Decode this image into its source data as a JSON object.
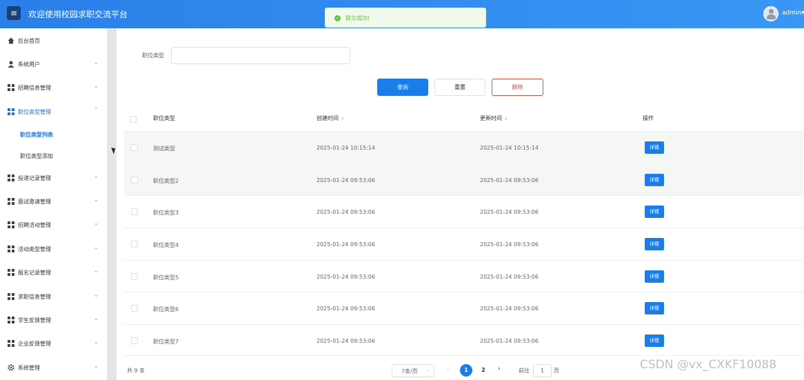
{
  "header": {
    "menu_icon": "hamburger-icon",
    "title": "欢迎使用校园求职交流平台",
    "username": "admin",
    "user_chevron": "▾",
    "accent": "#2a7fe8"
  },
  "toast": {
    "icon": "check-icon",
    "message": "提交成功!"
  },
  "sidebar": {
    "items": [
      {
        "label": "后台首页",
        "icon": "home-icon",
        "chevron": ""
      },
      {
        "label": "系统用户",
        "icon": "user-icon",
        "chevron": "⌄"
      },
      {
        "label": "招聘信息管理",
        "icon": "grid-icon",
        "chevron": "⌄"
      },
      {
        "label": "职位类型管理",
        "icon": "grid-icon",
        "chevron": "⌃"
      },
      {
        "label": "投递记录管理",
        "icon": "grid-icon",
        "chevron": "⌄"
      },
      {
        "label": "面试邀请管理",
        "icon": "grid-icon",
        "chevron": "⌄"
      },
      {
        "label": "招聘活动管理",
        "icon": "grid-icon",
        "chevron": "⌄"
      },
      {
        "label": "活动类型管理",
        "icon": "grid-icon",
        "chevron": "⌄"
      },
      {
        "label": "报名记录管理",
        "icon": "grid-icon",
        "chevron": "⌄"
      },
      {
        "label": "求职信息管理",
        "icon": "grid-icon",
        "chevron": "⌄"
      },
      {
        "label": "学生反馈管理",
        "icon": "grid-icon",
        "chevron": "⌄"
      },
      {
        "label": "企业反馈管理",
        "icon": "grid-icon",
        "chevron": "⌄"
      },
      {
        "label": "系统管理",
        "icon": "gear-icon",
        "chevron": "⌄"
      }
    ],
    "subitems": [
      {
        "label": "职位类型列表",
        "active": true
      },
      {
        "label": "职位类型添加",
        "active": false
      }
    ]
  },
  "filter": {
    "label": "职位类型",
    "value": "",
    "placeholder": ""
  },
  "buttons": {
    "query": "查询",
    "reset": "重置",
    "delete": "删除"
  },
  "table": {
    "headers": [
      "职位类型",
      "创建时间",
      "更新时间",
      "操作"
    ],
    "sort_icon": "⇕",
    "detail_label": "详情",
    "rows": [
      {
        "type": "测试类型",
        "created": "2025-01-24 10:15:14",
        "updated": "2025-01-24 10:15:14"
      },
      {
        "type": "职位类型2",
        "created": "2025-01-24 09:53:06",
        "updated": "2025-01-24 09:53:06"
      },
      {
        "type": "职位类型3",
        "created": "2025-01-24 09:53:06",
        "updated": "2025-01-24 09:53:06"
      },
      {
        "type": "职位类型4",
        "created": "2025-01-24 09:53:06",
        "updated": "2025-01-24 09:53:06"
      },
      {
        "type": "职位类型5",
        "created": "2025-01-24 09:53:06",
        "updated": "2025-01-24 09:53:06"
      },
      {
        "type": "职位类型6",
        "created": "2025-01-24 09:53:06",
        "updated": "2025-01-24 09:53:06"
      },
      {
        "type": "职位类型7",
        "created": "2025-01-24 09:53:06",
        "updated": "2025-01-24 09:53:06"
      }
    ]
  },
  "pagination": {
    "total": "共 9 条",
    "page_size": "7条/页",
    "pages": [
      "1",
      "2"
    ],
    "current_page": "1",
    "prev": "‹",
    "next": "›",
    "goto_label": "前往",
    "goto_value": "1",
    "goto_suffix": "页"
  },
  "watermark": "CSDN @vx_CXKF10088"
}
